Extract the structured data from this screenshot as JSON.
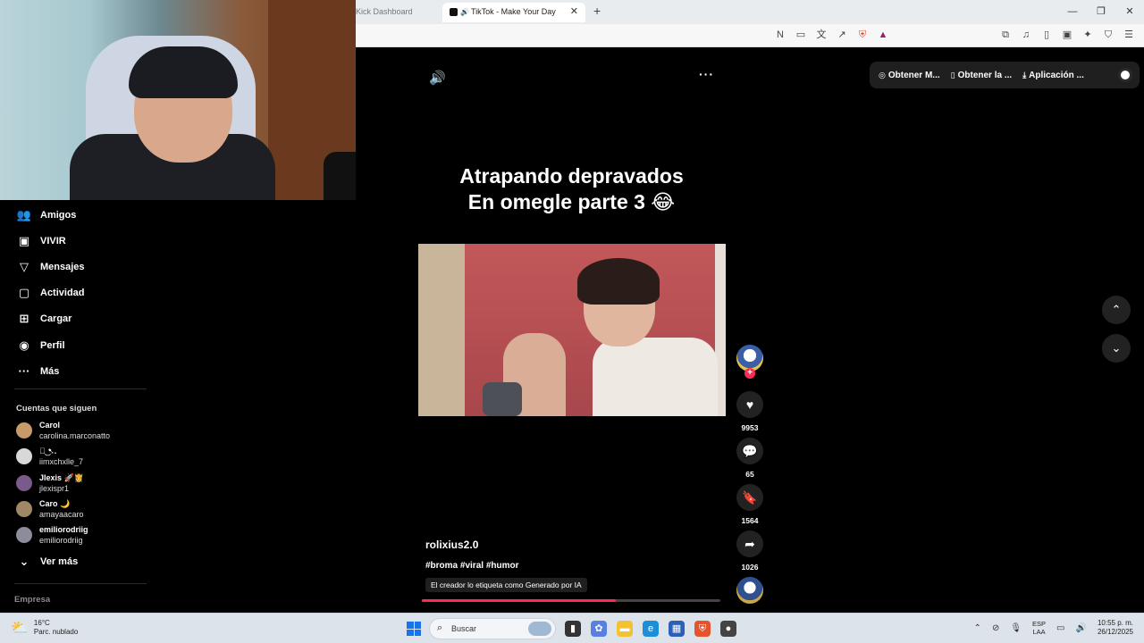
{
  "browser": {
    "tabs": [
      {
        "label": "Kick Dashboard",
        "active": false
      },
      {
        "label": "TikTok - Make Your Day",
        "active": true
      }
    ],
    "new_tab_icon": "plus-icon",
    "window_controls": [
      "minimize-icon",
      "restore-icon",
      "close-icon"
    ]
  },
  "sidebar": {
    "nav": [
      {
        "label": "Amigos",
        "icon": "friends-icon"
      },
      {
        "label": "VIVIR",
        "icon": "live-icon"
      },
      {
        "label": "Mensajes",
        "icon": "messages-icon"
      },
      {
        "label": "Actividad",
        "icon": "activity-icon"
      },
      {
        "label": "Cargar",
        "icon": "upload-icon"
      },
      {
        "label": "Perfil",
        "icon": "profile-icon"
      },
      {
        "label": "Más",
        "icon": "more-icon"
      }
    ],
    "following_title": "Cuentas que siguen",
    "following": [
      {
        "name": "Carol",
        "user": "carolina.marconatto",
        "color": "#c79a6a"
      },
      {
        "name": "ཀ͜ ➷.",
        "user": "iimxchxlle_7",
        "color": "#d8d8d8"
      },
      {
        "name": "Jlexis 🚀👸",
        "user": "jlexispr1",
        "color": "#7a5a8a"
      },
      {
        "name": "Caro 🌙",
        "user": "amayaacaro",
        "color": "#a08866"
      },
      {
        "name": "emiliorodriig",
        "user": "emiliorodriig",
        "color": "#8c8c9a"
      }
    ],
    "see_more": "Ver más",
    "company": "Empresa"
  },
  "header": {
    "pill": [
      {
        "label": "Obtener M...",
        "icon": "coin-icon"
      },
      {
        "label": "Obtener la ...",
        "icon": "phone-icon"
      },
      {
        "label": "Aplicación ...",
        "icon": "download-icon"
      }
    ]
  },
  "post": {
    "caption_line1": "Atrapando depravados",
    "caption_line2": "En omegle parte 3 😂",
    "creator": "rolixius2.0",
    "tags": "#broma #viral #humor",
    "ai_label": "El creador lo etiqueta como Generado por IA",
    "progress": 0.65,
    "likes": "9953",
    "comments": "65",
    "saves": "1564",
    "shares": "1026"
  },
  "taskbar": {
    "temp": "16°C",
    "weather": "Parc. nublado",
    "search": "Buscar",
    "lang1": "ESP",
    "lang2": "LAA",
    "time": "10:55 p. m.",
    "date": "26/12/2025"
  },
  "colors": {
    "accent": "#fe2c55",
    "background": "#000000",
    "taskbar": "#dde3ea"
  }
}
